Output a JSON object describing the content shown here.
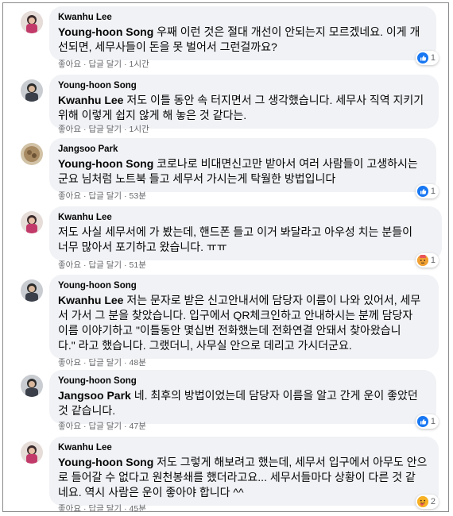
{
  "comments": [
    {
      "author": "Kwanhu Lee",
      "mention": "Young-hoon Song",
      "text1": " 우째 이런 것은 절대 개선이 안되는지 모르겠네요. 이게 개",
      "text2": "선되면, 세무사들이 돈을 못 벌어서 그런걸까요?",
      "like": "좋아요",
      "reply": "답글 달기",
      "time": "1시간",
      "reaction": "1"
    },
    {
      "author": "Young-hoon Song",
      "mention": "Kwanhu Lee",
      "text1": " 저도 이틀 동안 속 터지면서 그 생각했습니다. 세무사 직역 지키기",
      "text2": "위해 이렇게 쉽지 않게 해 놓은 것 같다는.",
      "like": "좋아요",
      "reply": "답글 달기",
      "time": "1시간"
    },
    {
      "author": "Jangsoo Park",
      "mention": "Young-hoon Song",
      "text1": " 코로나로 비대면신고만 받아서 여러 사람들이 고생하시는",
      "text2": "군요 님처럼 노트북 들고 세무서 가시는게 탁월한 방법입니다",
      "like": "좋아요",
      "reply": "답글 달기",
      "time": "53분",
      "reaction": "1"
    },
    {
      "author": "Kwanhu Lee",
      "mention": "",
      "text1": "저도 사실 세무서에 가 봤는데, 핸드폰 들고 이거 봐달라고 아우성 치는 분들이",
      "text2": "너무 많아서 포기하고 왔습니다. ㅠㅠ",
      "like": "좋아요",
      "reply": "답글 달기",
      "time": "51분",
      "reaction": "1"
    },
    {
      "author": "Young-hoon Song",
      "mention": "Kwanhu Lee",
      "text1": " 저는 문자로 받은 신고안내서에 담당자 이름이 나와 있어서, 세무",
      "text2": "서 가서 그 분을 찾았습니다. 입구에서 QR체크인하고 안내하시는 분께 담당자",
      "text3": "이름 이야기하고 \"이틀동안 몇십번 전화했는데 전화연결 안돼서 찾아왔습니",
      "text4": "다.\" 라고 했습니다. 그랬더니, 사무실 안으로 데리고 가시더군요.",
      "like": "좋아요",
      "reply": "답글 달기",
      "time": "48분"
    },
    {
      "author": "Young-hoon Song",
      "mention": "Jangsoo Park",
      "text1": " 네. 최후의 방법이었는데 담당자 이름을 알고 간게 운이 좋았던",
      "text2": "것 같습니다.",
      "like": "좋아요",
      "reply": "답글 달기",
      "time": "47분",
      "reaction": "1"
    },
    {
      "author": "Kwanhu Lee",
      "mention": "Young-hoon Song",
      "text1": " 저도 그렇게 해보려고 했는데, 세무서 입구에서 아무도 안으",
      "text2": "로 들어갈 수 없다고 원천봉쇄를 했더라고요... 세무서들마다 상황이 다른 것 같",
      "text3": "네요. 역시 사람은 운이 좋아야 합니다 ^^",
      "like": "좋아요",
      "reply": "답글 달기",
      "time": "45분",
      "reaction": "2"
    }
  ]
}
